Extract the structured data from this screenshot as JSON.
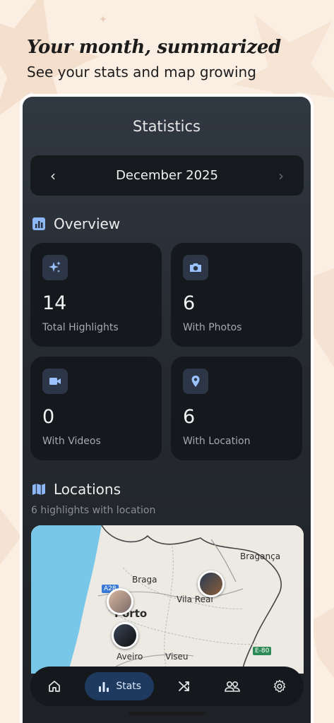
{
  "promo": {
    "headline": "Your month, summarized",
    "subline": "See your stats and map growing"
  },
  "screen": {
    "title": "Statistics",
    "month_selector": {
      "label": "December 2025",
      "prev_icon": "chevron-left-icon",
      "next_icon": "chevron-right-icon",
      "next_disabled": true
    },
    "overview": {
      "heading": "Overview",
      "icon": "bar-chart-icon",
      "cards": [
        {
          "icon": "sparkles-icon",
          "value": "14",
          "caption": "Total Highlights"
        },
        {
          "icon": "camera-icon",
          "value": "6",
          "caption": "With Photos"
        },
        {
          "icon": "video-icon",
          "value": "0",
          "caption": "With Videos"
        },
        {
          "icon": "location-pin-icon",
          "value": "6",
          "caption": "With Location"
        }
      ]
    },
    "locations": {
      "heading": "Locations",
      "icon": "map-icon",
      "subtitle": "6 highlights with location",
      "map_labels": {
        "braga": "Braga",
        "braganca": "Bragança",
        "porto": "Porto",
        "vila_real": "Vila Real",
        "aveiro": "Aveiro",
        "viseu": "Viseu",
        "a28": "A28",
        "e80": "E-80"
      }
    },
    "nav": {
      "items": [
        {
          "icon": "home-icon",
          "label": ""
        },
        {
          "icon": "bar-chart-icon",
          "label": "Stats",
          "active": true
        },
        {
          "icon": "shuffle-icon",
          "label": ""
        },
        {
          "icon": "people-icon",
          "label": ""
        },
        {
          "icon": "gear-icon",
          "label": ""
        }
      ]
    }
  },
  "colors": {
    "background": "#fbeee3",
    "accent": "#1f3a5f",
    "card": "#15181c",
    "icon_tint": "#9cc3ff",
    "sea": "#79c7e8"
  }
}
